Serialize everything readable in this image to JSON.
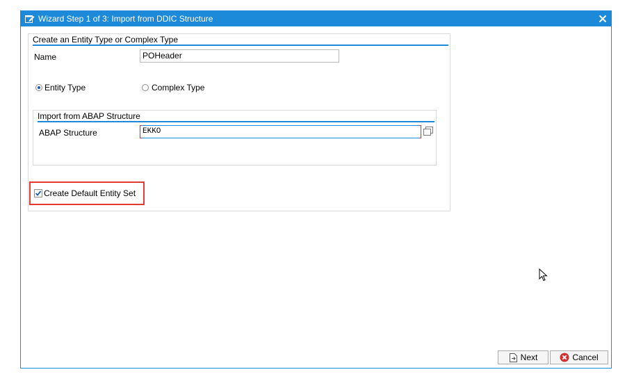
{
  "window": {
    "title": "Wizard Step 1 of 3: Import from DDIC Structure",
    "title_bar_color": "#1c8ad8"
  },
  "entity_group": {
    "title": "Create an Entity Type or Complex Type",
    "name_label": "Name",
    "name_value": "POHeader",
    "entity_type_label": "Entity Type",
    "complex_type_label": "Complex Type",
    "selected_type": "Entity Type"
  },
  "abap_group": {
    "title": "Import from ABAP Structure",
    "structure_label": "ABAP Structure",
    "structure_value": "EKKO"
  },
  "default_entity_set": {
    "label": "Create Default Entity Set",
    "checked": true,
    "highlight_color": "#e53935"
  },
  "buttons": {
    "next_label": "Next",
    "cancel_label": "Cancel"
  }
}
